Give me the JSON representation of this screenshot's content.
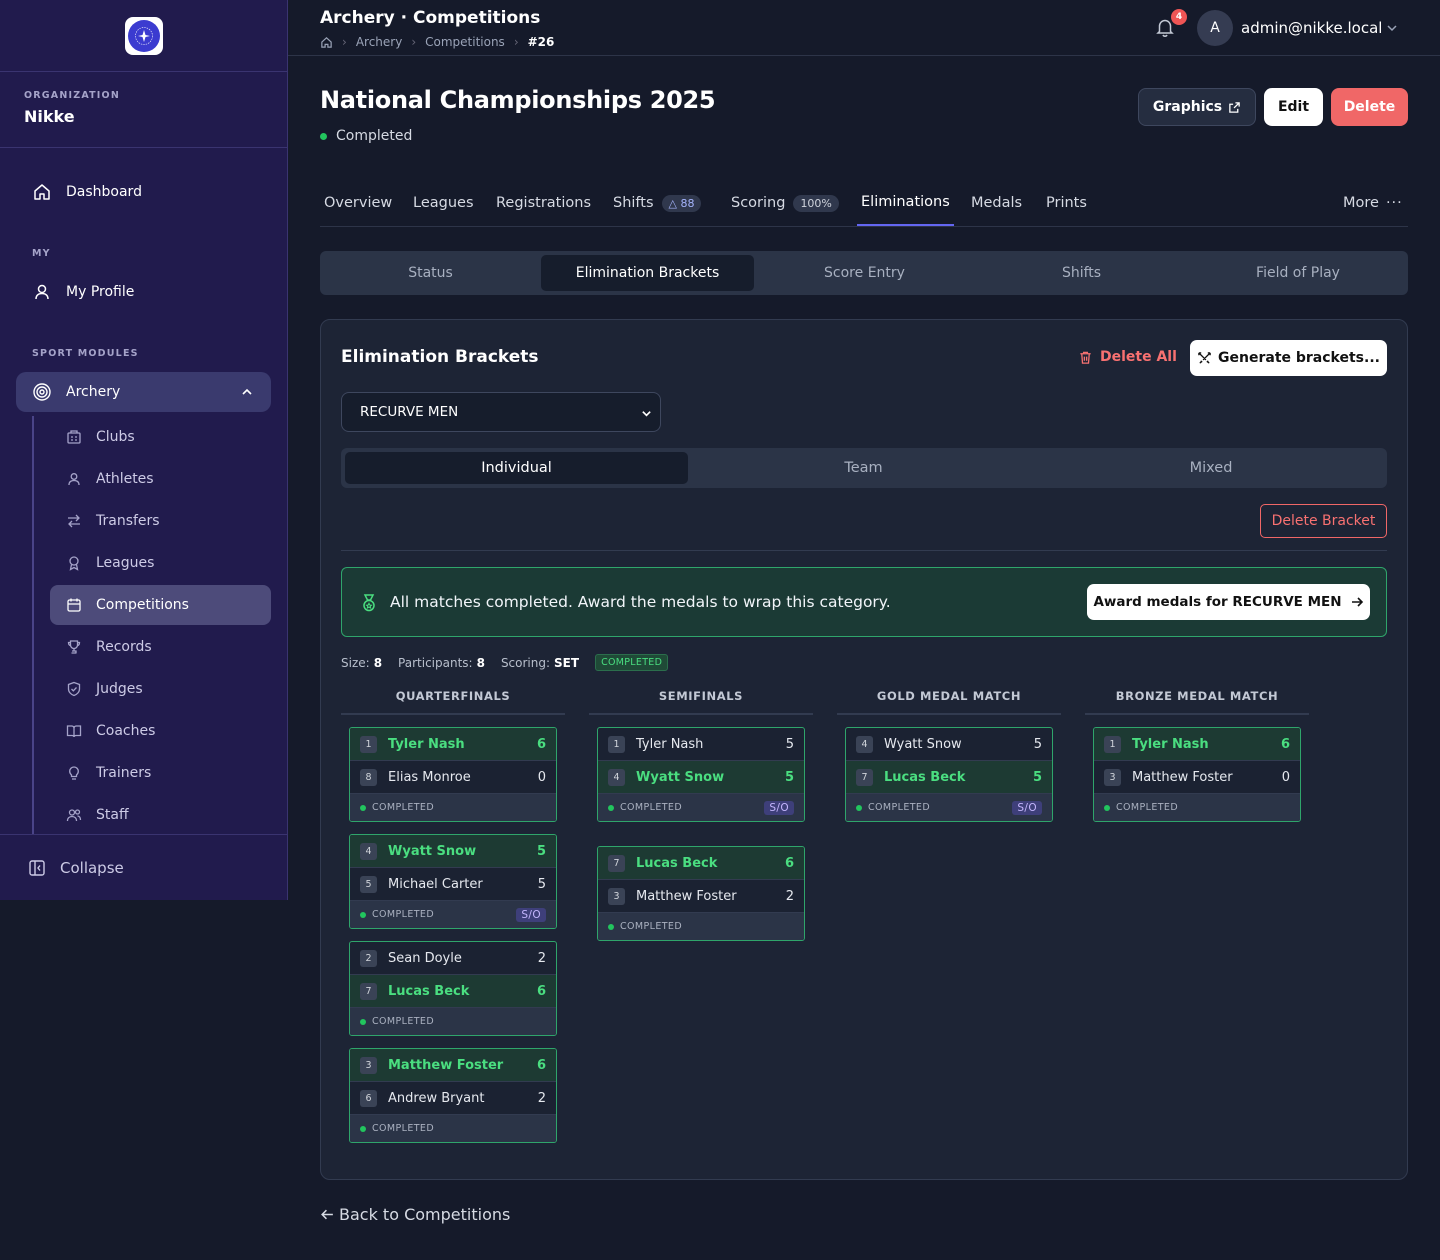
{
  "sidebar": {
    "org_kicker": "ORGANIZATION",
    "org_name": "Nikke",
    "dashboard": "Dashboard",
    "my_kicker": "MY",
    "my_profile": "My Profile",
    "modules_kicker": "SPORT MODULES",
    "archery": "Archery",
    "items": [
      "Clubs",
      "Athletes",
      "Transfers",
      "Leagues",
      "Competitions",
      "Records",
      "Judges",
      "Coaches",
      "Trainers",
      "Staff"
    ],
    "collapse": "Collapse"
  },
  "header": {
    "title": "Archery · Competitions",
    "crumbs": [
      "Archery",
      "Competitions",
      "#26"
    ],
    "notif_count": "4",
    "avatar_letter": "A",
    "user_email": "admin@nikke.local"
  },
  "page": {
    "title": "National Championships 2025",
    "status": "Completed",
    "graphics": "Graphics",
    "edit": "Edit",
    "delete": "Delete"
  },
  "tabs": [
    {
      "label": "Overview"
    },
    {
      "label": "Leagues"
    },
    {
      "label": "Registrations"
    },
    {
      "label": "Shifts",
      "pill": "88"
    },
    {
      "label": "Scoring",
      "pill": "100%"
    },
    {
      "label": "Eliminations"
    },
    {
      "label": "Medals"
    },
    {
      "label": "Prints"
    }
  ],
  "more": "More",
  "subtabs": [
    "Status",
    "Elimination Brackets",
    "Score Entry",
    "Shifts",
    "Field of Play"
  ],
  "card": {
    "title": "Elimination Brackets",
    "delete_all": "Delete All",
    "generate": "Generate brackets...",
    "category": "RECURVE MEN",
    "segments": [
      "Individual",
      "Team",
      "Mixed"
    ],
    "delete_bracket": "Delete Bracket",
    "alert_text": "All matches completed. Award the medals to wrap this category.",
    "award_button": "Award medals for RECURVE MEN",
    "meta": {
      "size_label": "Size:",
      "size": "8",
      "participants_label": "Participants:",
      "participants": "8",
      "scoring_label": "Scoring:",
      "scoring": "SET",
      "status": "COMPLETED"
    },
    "rounds": [
      "QUARTERFINALS",
      "SEMIFINALS",
      "GOLD MEDAL MATCH",
      "BRONZE MEDAL MATCH"
    ]
  },
  "matches": {
    "qf1": {
      "a": {
        "seed": "1",
        "name": "Tyler Nash",
        "score": "6",
        "win": true
      },
      "b": {
        "seed": "8",
        "name": "Elias Monroe",
        "score": "0"
      },
      "status": "COMPLETED"
    },
    "qf2": {
      "a": {
        "seed": "4",
        "name": "Wyatt Snow",
        "score": "5",
        "win": true
      },
      "b": {
        "seed": "5",
        "name": "Michael Carter",
        "score": "5"
      },
      "status": "COMPLETED",
      "so": "S/O"
    },
    "qf3": {
      "a": {
        "seed": "2",
        "name": "Sean Doyle",
        "score": "2"
      },
      "b": {
        "seed": "7",
        "name": "Lucas Beck",
        "score": "6",
        "win": true
      },
      "status": "COMPLETED"
    },
    "qf4": {
      "a": {
        "seed": "3",
        "name": "Matthew Foster",
        "score": "6",
        "win": true
      },
      "b": {
        "seed": "6",
        "name": "Andrew Bryant",
        "score": "2"
      },
      "status": "COMPLETED"
    },
    "sf1": {
      "a": {
        "seed": "1",
        "name": "Tyler Nash",
        "score": "5"
      },
      "b": {
        "seed": "4",
        "name": "Wyatt Snow",
        "score": "5",
        "win": true
      },
      "status": "COMPLETED",
      "so": "S/O"
    },
    "sf2": {
      "a": {
        "seed": "7",
        "name": "Lucas Beck",
        "score": "6",
        "win": true
      },
      "b": {
        "seed": "3",
        "name": "Matthew Foster",
        "score": "2"
      },
      "status": "COMPLETED"
    },
    "gold": {
      "a": {
        "seed": "4",
        "name": "Wyatt Snow",
        "score": "5"
      },
      "b": {
        "seed": "7",
        "name": "Lucas Beck",
        "score": "5",
        "win": true
      },
      "status": "COMPLETED",
      "so": "S/O"
    },
    "bronze": {
      "a": {
        "seed": "1",
        "name": "Tyler Nash",
        "score": "6",
        "win": true
      },
      "b": {
        "seed": "3",
        "name": "Matthew Foster",
        "score": "0"
      },
      "status": "COMPLETED"
    }
  },
  "back": "Back to Competitions",
  "colors": {
    "accent": "#6366f1",
    "success": "#22c55e",
    "danger": "#f06767",
    "sidebar": "#211b4d",
    "bg": "#151a2a"
  }
}
